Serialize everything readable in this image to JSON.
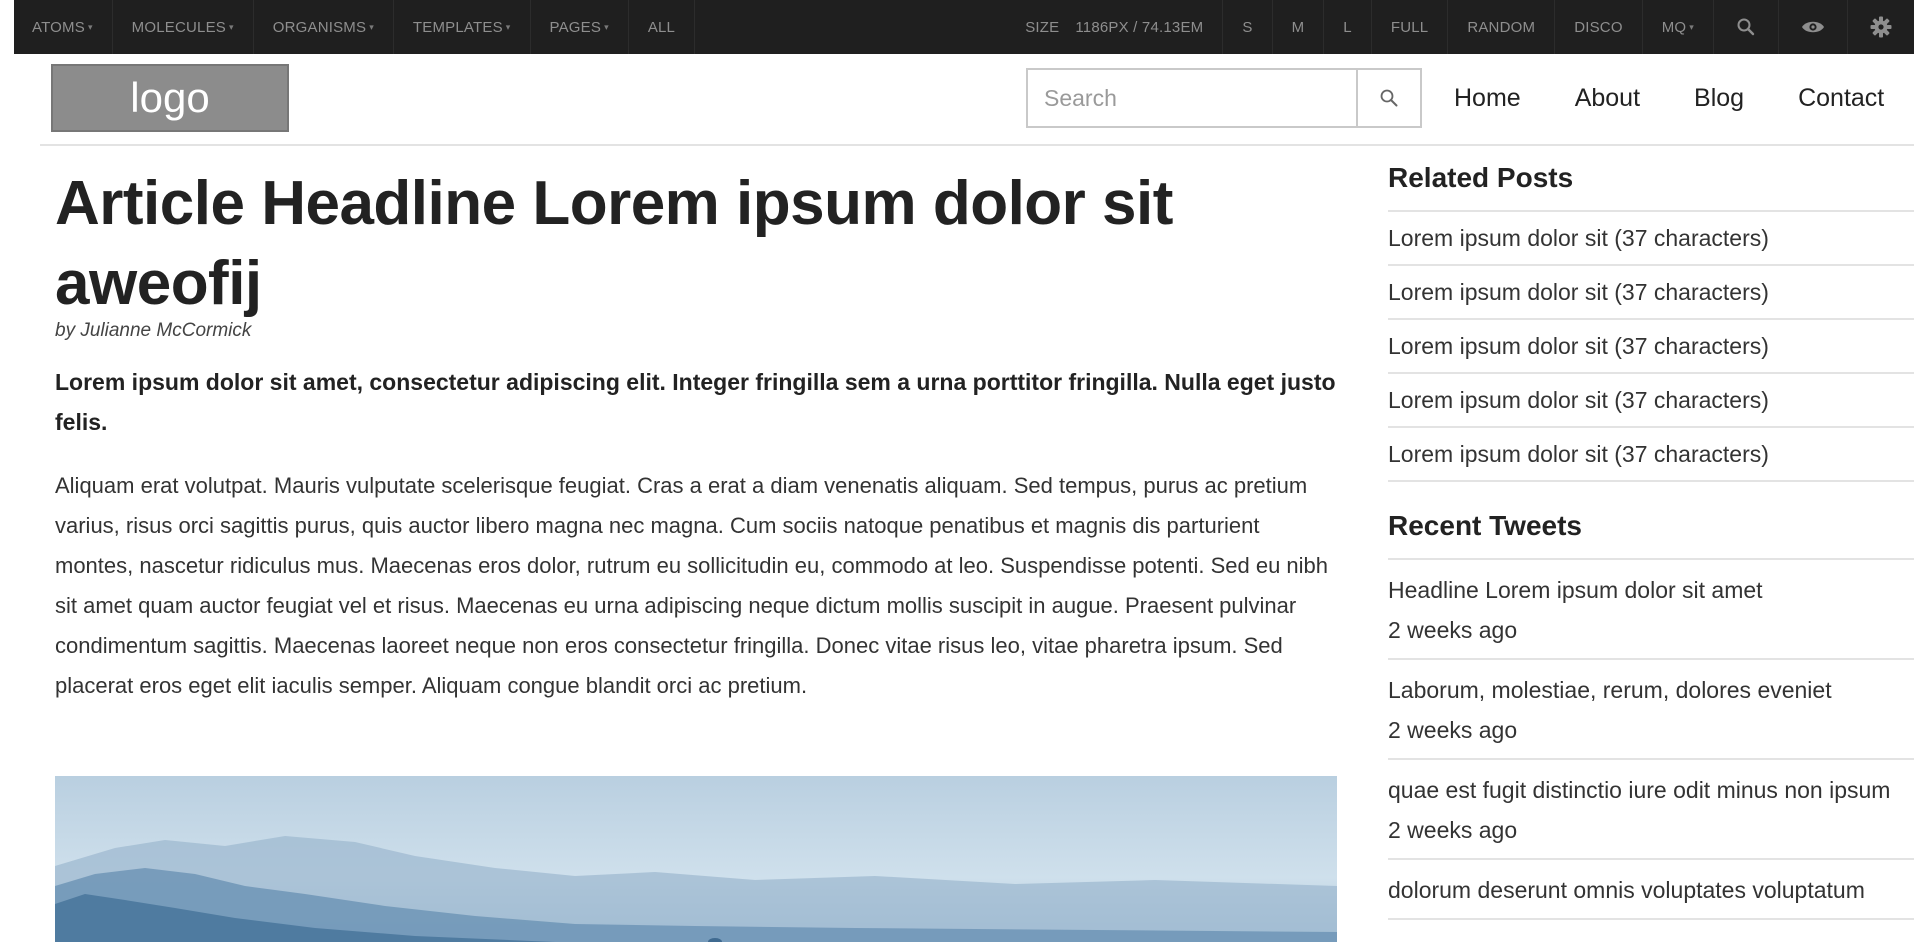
{
  "toolbar": {
    "left_items": [
      {
        "label": "ATOMS",
        "has_caret": true
      },
      {
        "label": "MOLECULES",
        "has_caret": true
      },
      {
        "label": "ORGANISMS",
        "has_caret": true
      },
      {
        "label": "TEMPLATES",
        "has_caret": true
      },
      {
        "label": "PAGES",
        "has_caret": true
      },
      {
        "label": "ALL",
        "has_caret": false
      }
    ],
    "size_label": "SIZE",
    "size_value": "1186PX / 74.13EM",
    "right_items": [
      "S",
      "M",
      "L",
      "FULL",
      "RANDOM",
      "DISCO"
    ],
    "mq_label": "MQ",
    "caret": "▾",
    "icons": [
      "search-icon",
      "eye-icon",
      "gear-icon"
    ]
  },
  "header": {
    "logo": "logo",
    "search": {
      "placeholder": "Search",
      "value": ""
    },
    "nav": [
      "Home",
      "About",
      "Blog",
      "Contact"
    ]
  },
  "article": {
    "headline": "Article Headline Lorem ipsum dolor sit aweofij",
    "byline": "by Julianne McCormick",
    "lede": "Lorem ipsum dolor sit amet, consectetur adipiscing elit. Integer fringilla sem a urna porttitor fringilla. Nulla eget justo felis.",
    "body": "Aliquam erat volutpat. Mauris vulputate scelerisque feugiat. Cras a erat a diam venenatis aliquam. Sed tempus, purus ac pretium varius, risus orci sagittis purus, quis auctor libero magna nec magna. Cum sociis natoque penatibus et magnis dis parturient montes, nascetur ridiculus mus. Maecenas eros dolor, rutrum eu sollicitudin eu, commodo at leo. Suspendisse potenti. Sed eu nibh sit amet quam auctor feugiat vel et risus. Maecenas eu urna adipiscing neque dictum mollis suscipit in augue. Praesent pulvinar condimentum sagittis. Maecenas laoreet neque non eros consectetur fringilla. Donec vitae risus leo, vitae pharetra ipsum. Sed placerat eros eget elit iaculis semper. Aliquam congue blandit orci ac pretium."
  },
  "sidebar": {
    "related_heading": "Related Posts",
    "related": [
      "Lorem ipsum dolor sit (37 characters)",
      "Lorem ipsum dolor sit (37 characters)",
      "Lorem ipsum dolor sit (37 characters)",
      "Lorem ipsum dolor sit (37 characters)",
      "Lorem ipsum dolor sit (37 characters)"
    ],
    "tweets_heading": "Recent Tweets",
    "tweets": [
      {
        "text": "Headline Lorem ipsum dolor sit amet",
        "time": "2 weeks ago"
      },
      {
        "text": "Laborum, molestiae, rerum, dolores eveniet",
        "time": "2 weeks ago"
      },
      {
        "text": "quae est fugit distinctio iure odit minus non ipsum",
        "time": "2 weeks ago"
      },
      {
        "text": "dolorum deserunt omnis voluptates voluptatum",
        "time": ""
      }
    ]
  },
  "colors": {
    "toolbar_bg": "#1f1f1f",
    "toolbar_text": "#8e8e8e",
    "logo_bg": "#8c8c8c",
    "divider": "#e3e3e3"
  }
}
